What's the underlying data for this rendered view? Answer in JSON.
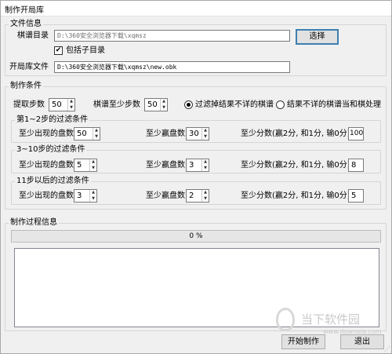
{
  "window": {
    "title": "制作开局库"
  },
  "file_info": {
    "legend": "文件信息",
    "dir_label": "棋谱目录",
    "dir_value": "D:\\360安全浏览器下载\\xqmsz",
    "browse_label": "选择",
    "include_sub_label": "包括子目录",
    "include_sub_checked": true,
    "out_label": "开局库文件",
    "out_value": "D:\\360安全浏览器下载\\xqmsz\\new.obk"
  },
  "conditions": {
    "legend": "制作条件",
    "extract_steps_label": "提取步数",
    "extract_steps_value": "50",
    "min_steps_label": "棋谱至少步数",
    "min_steps_value": "50",
    "radio1_label": "过滤掉结果不详的棋谱",
    "radio2_label": "结果不详的棋谱当和棋处理",
    "selected_radio": 1,
    "groups": [
      {
        "legend": "第1~2步的过滤条件",
        "min_games_label": "至少出现的盘数",
        "min_games": "50",
        "min_wins_label": "至少赢盘数",
        "min_wins": "30",
        "min_score_label": "至少分数(赢2分, 和1分, 输0分)",
        "min_score": "100"
      },
      {
        "legend": "3~10步的过滤条件",
        "min_games_label": "至少出现的盘数",
        "min_games": "5",
        "min_wins_label": "至少赢盘数",
        "min_wins": "3",
        "min_score_label": "至少分数(赢2分, 和1分, 输0分)",
        "min_score": "8"
      },
      {
        "legend": "11步以后的过滤条件",
        "min_games_label": "至少出现的盘数",
        "min_games": "3",
        "min_wins_label": "至少赢盘数",
        "min_wins": "2",
        "min_score_label": "至少分数(赢2分, 和1分, 输0分)",
        "min_score": "5"
      }
    ]
  },
  "process": {
    "legend": "制作过程信息",
    "progress_text": "0 %",
    "progress_value": 0,
    "log_text": ""
  },
  "buttons": {
    "start_label": "开始制作",
    "exit_label": "退出"
  },
  "watermark": {
    "brand": "当下软件园",
    "url": "www.downxia.com"
  }
}
